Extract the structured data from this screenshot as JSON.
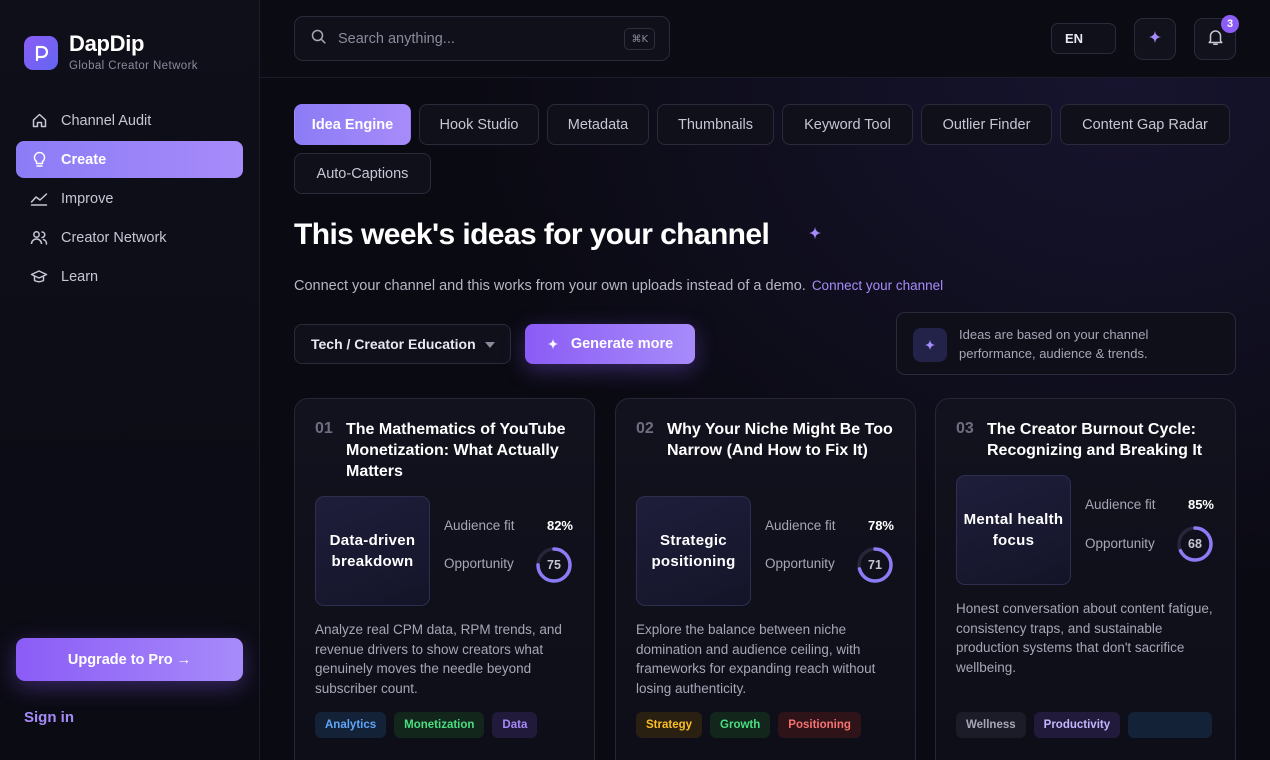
{
  "brand": {
    "name": "DapDip",
    "tagline": "Global Creator Network"
  },
  "sidebar": {
    "items": [
      {
        "label": "Channel Audit",
        "icon": "home-icon"
      },
      {
        "label": "Create",
        "icon": "lightbulb-icon",
        "active": true
      },
      {
        "label": "Improve",
        "icon": "trend-icon"
      },
      {
        "label": "Creator Network",
        "icon": "users-icon"
      },
      {
        "label": "Learn",
        "icon": "graduation-cap-icon"
      }
    ],
    "upgrade_label": "Upgrade to Pro →",
    "signin_label": "Sign in"
  },
  "header": {
    "search_placeholder": "Search anything...",
    "search_shortcut": "⌘K",
    "language": "EN",
    "notification_count": "3"
  },
  "tabs": [
    "Idea Engine",
    "Hook Studio",
    "Metadata",
    "Thumbnails",
    "Keyword Tool",
    "Outlier Finder",
    "Content Gap Radar",
    "Auto-Captions"
  ],
  "main": {
    "title": "This week's ideas for your channel",
    "subline": "Connect your channel and this works from your own uploads instead of a demo.",
    "connect_link": "Connect your channel",
    "niche_select": "Tech / Creator Education",
    "generate_label": "Generate more",
    "info_text": "Ideas are based on your channel performance, audience & trends."
  },
  "cards": [
    {
      "num": "01",
      "title": "The Mathematics of YouTube Monetization: What Actually Matters",
      "thumb": "Data-driven breakdown",
      "audience_label": "Audience fit",
      "audience_fit": "82%",
      "opportunity_label": "Opportunity",
      "opportunity": 75,
      "opportunity_text": "75",
      "description": "Analyze real CPM data, RPM trends, and revenue drivers to show creators what genuinely moves the needle beyond subscriber count.",
      "tags": [
        {
          "label": "Analytics",
          "color": "#60a5fa",
          "bg": "#132236"
        },
        {
          "label": "Monetization",
          "color": "#4ade80",
          "bg": "#12261c"
        },
        {
          "label": "Data",
          "color": "#a78bfa",
          "bg": "#221a3a"
        }
      ]
    },
    {
      "num": "02",
      "title": "Why Your Niche Might Be Too Narrow (And How to Fix It)",
      "thumb": "Strategic positioning",
      "audience_label": "Audience fit",
      "audience_fit": "78%",
      "opportunity_label": "Opportunity",
      "opportunity": 71,
      "opportunity_text": "71",
      "description": "Explore the balance between niche domination and audience ceiling, with frameworks for expanding reach without losing authenticity.",
      "tags": [
        {
          "label": "Strategy",
          "color": "#fbbf24",
          "bg": "#2a2012"
        },
        {
          "label": "Growth",
          "color": "#4ade80",
          "bg": "#12261c"
        },
        {
          "label": "Positioning",
          "color": "#f87171",
          "bg": "#2e1418"
        }
      ]
    },
    {
      "num": "03",
      "title": "The Creator Burnout Cycle: Recognizing and Breaking It",
      "thumb": "Mental health focus",
      "audience_label": "Audience fit",
      "audience_fit": "85%",
      "opportunity_label": "Opportunity",
      "opportunity": 68,
      "opportunity_text": "68",
      "description": "Honest conversation about content fatigue, consistency traps, and sustainable production systems that don't sacrifice wellbeing.",
      "tags": [
        {
          "label": "Wellness",
          "color": "#a6a6b6",
          "bg": "#1c1c28"
        },
        {
          "label": "Productivity",
          "color": "#c4b5fd",
          "bg": "#221a3a"
        },
        {
          "label": "",
          "color": "#60a5fa",
          "bg": "#132236"
        }
      ]
    }
  ],
  "colors": {
    "accent": "#8b5cf6",
    "accent_light": "#a78bfa",
    "bg": "#0a0a12"
  }
}
